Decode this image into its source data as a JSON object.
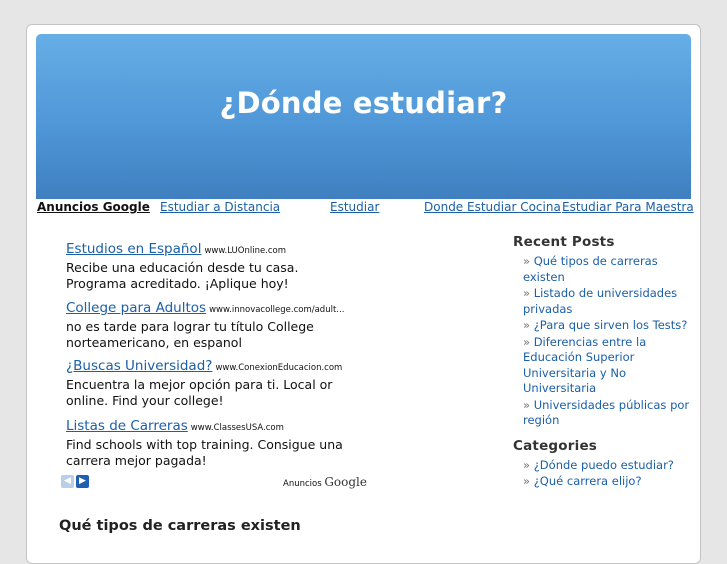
{
  "header": {
    "title": "¿Dónde estudiar?"
  },
  "ad_links": {
    "label": "Anuncios Google",
    "links": [
      "Estudiar a Distancia",
      "Estudiar",
      "Donde Estudiar Cocina",
      "Estudiar Para Maestra"
    ]
  },
  "ads": [
    {
      "title": "Estudios en Español",
      "url": "www.LUOnline.com",
      "line1": "Recibe una educación desde tu casa.",
      "line2": "Programa acreditado. ¡Aplique hoy!"
    },
    {
      "title": "College para Adultos",
      "url": "www.innovacollege.com/adult...",
      "line1": "no es tarde para lograr tu título College",
      "line2": "norteamericano, en espanol"
    },
    {
      "title": "¿Buscas Universidad?",
      "url": "www.ConexionEducacion.com",
      "line1": "Encuentra la mejor opción para ti. Local or",
      "line2": "online. Find your college!"
    },
    {
      "title": "Listas de Carreras",
      "url": "www.ClassesUSA.com",
      "line1": "Find schools with top training. Consigue una",
      "line2": "carrera mejor pagada!"
    }
  ],
  "ads_footer": {
    "prev_icon": "chevron-left-icon",
    "next_icon": "chevron-right-icon",
    "prefix": "Anuncios",
    "brand": "Google"
  },
  "main": {
    "post_title": "Qué tipos de carreras existen"
  },
  "sidebar": {
    "bullet": "»",
    "recent_heading": "Recent Posts",
    "recent_posts": [
      [
        "Qué tipos de carreras",
        "existen"
      ],
      [
        "Listado de universidades",
        "privadas"
      ],
      [
        "¿Para que sirven los Tests?"
      ],
      [
        "Diferencias entre la",
        "Educación Superior",
        "Universitaria y No",
        "Universitaria"
      ],
      [
        "Universidades públicas por",
        "región"
      ]
    ],
    "categories_heading": "Categories",
    "categories": [
      [
        "¿Dónde puedo estudiar?"
      ],
      [
        "¿Qué carrera elijo?"
      ]
    ]
  },
  "colors": {
    "link": "#1a5fa8",
    "banner_top": "#66aee6",
    "banner_bottom": "#3f7fc0",
    "page_bg": "#e6e6e6"
  }
}
